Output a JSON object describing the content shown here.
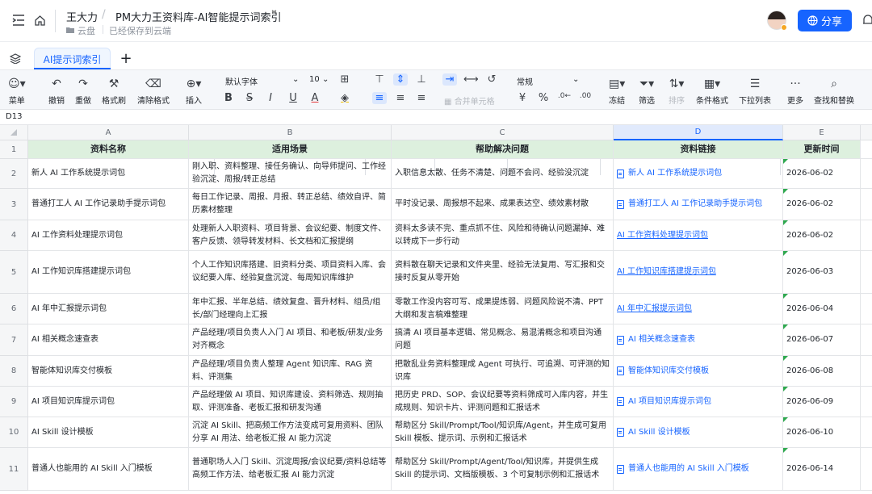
{
  "header": {
    "user": "王大力",
    "doc_title": "PM大力王资料库-AI智能提示词索引",
    "location": "云盘",
    "save_status": "已经保存到云端",
    "share_label": "分享"
  },
  "sheet_tabs": [
    {
      "label": "AI提示词索引"
    }
  ],
  "toolbar": {
    "menu": "菜单",
    "undo": "撤销",
    "redo": "重做",
    "format_painter": "格式刷",
    "clear_format": "清除格式",
    "insert": "插入",
    "font": "默认字体",
    "font_size": "10",
    "merge": "合并单元格",
    "number_format": "常规",
    "freeze": "冻结",
    "filter": "筛选",
    "sort": "排序",
    "conditional_format": "条件格式",
    "dropdown_list": "下拉列表",
    "more": "更多",
    "find_replace": "查找和替换",
    "currency_glyph": "¥",
    "percent_glyph": "%"
  },
  "name_box": "D13",
  "grid": {
    "columns": [
      "A",
      "B",
      "C",
      "D",
      "E"
    ],
    "rows": [
      {
        "num": "1",
        "a": "资料名称",
        "b": "适用场景",
        "c": "帮助解决问题",
        "d": "资料链接",
        "e": "更新时间"
      },
      {
        "num": "2",
        "a": "新人 AI 工作系统提示词包",
        "b": "刚入职、资料整理、接任务确认、向导师提问、工作经验沉淀、周报/转正总结",
        "c": "入职信息太散、任务不清楚、问题不会问、经验没沉淀",
        "d": "新人 AI 工作系统提示词包",
        "e": "2026-06-02"
      },
      {
        "num": "3",
        "a": "普通打工人 AI 工作记录助手提示词包",
        "b": "每日工作记录、周报、月报、转正总结、绩效自评、简历素材整理",
        "c": "平时没记录、周报想不起来、成果表达空、绩效素材散",
        "d": "普通打工人 AI 工作记录助手提示词包",
        "e": "2026-06-02"
      },
      {
        "num": "4",
        "a": "AI 工作资料处理提示词包",
        "b": "处理新人入职资料、项目背景、会议纪要、制度文件、客户反馈、领导转发材料、长文档和汇报提纲",
        "c": "资料太多读不完、重点抓不住、风险和待确认问题漏掉、难以转成下一步行动",
        "d": "AI 工作资料处理提示词包",
        "e": "2026-06-02"
      },
      {
        "num": "5",
        "a": "AI 工作知识库搭建提示词包",
        "b": "个人工作知识库搭建、旧资料分类、项目资料入库、会议纪要入库、经验复盘沉淀、每周知识库维护",
        "c": "资料散在聊天记录和文件夹里、经验无法复用、写汇报和交接时反复从零开始",
        "d": "AI 工作知识库搭建提示词包",
        "e": "2026-06-03"
      },
      {
        "num": "6",
        "a": "AI 年中汇报提示词包",
        "b": "年中汇报、半年总结、绩效复盘、晋升材料、组员/组长/部门经理向上汇报",
        "c": "零散工作没内容可写、成果提炼弱、问题风险说不清、PPT大纲和发言稿难整理",
        "d": "AI 年中汇报提示词包",
        "e": "2026-06-04"
      },
      {
        "num": "7",
        "a": "AI 相关概念速查表",
        "b": "产品经理/项目负责人入门 AI 项目、和老板/研发/业务对齐概念",
        "c": "搞清 AI 项目基本逻辑、常见概念、易混淆概念和项目沟通问题",
        "d": "AI 相关概念速查表",
        "e": "2026-06-07"
      },
      {
        "num": "8",
        "a": "智能体知识库交付模板",
        "b": "产品经理/项目负责人整理 Agent 知识库、RAG 资料、评测集",
        "c": "把散乱业务资料整理成 Agent 可执行、可追溯、可评测的知识库",
        "d": "智能体知识库交付模板",
        "e": "2026-06-08"
      },
      {
        "num": "9",
        "a": "AI 项目知识库提示词包",
        "b": "产品经理做 AI 项目、知识库建设、资料筛选、规则抽取、评测准备、老板汇报和研发沟通",
        "c": "把历史 PRD、SOP、会议纪要等资料筛成可入库内容，并生成规则、知识卡片、评测问题和汇报话术",
        "d": "AI 项目知识库提示词包",
        "e": "2026-06-09"
      },
      {
        "num": "10",
        "a": "AI Skill 设计模板",
        "b": "沉淀 AI Skill、把高频工作方法变成可复用资料、团队分享 AI 用法、给老板汇报 AI 能力沉淀",
        "c": "帮助区分 Skill/Prompt/Tool/知识库/Agent，并生成可复用 Skill 模板、提示词、示例和汇报话术",
        "d": "AI Skill 设计模板",
        "e": "2026-06-10"
      },
      {
        "num": "11",
        "a": "普通人也能用的 AI Skill 入门模板",
        "b": "普通职场人入门 Skill、沉淀周报/会议纪要/资料总结等高频工作方法、给老板汇报 AI 能力沉淀",
        "c": "帮助区分 Skill/Prompt/Agent/Tool/知识库，并提供生成 Skill 的提示词、文档版模板、3 个可复制示例和汇报话术",
        "d": "普通人也能用的 AI Skill 入门模板",
        "e": "2026-06-14"
      }
    ]
  },
  "colors": {
    "accent": "#1664ff",
    "header_fill": "#ddf0de",
    "date_flag": "#2fa84f"
  }
}
